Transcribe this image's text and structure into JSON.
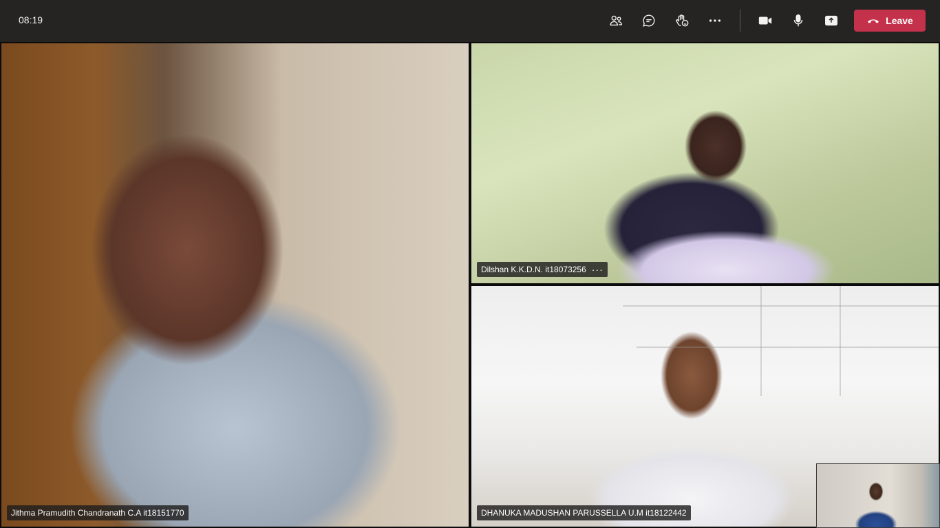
{
  "header": {
    "time": "08:19",
    "toolbar": {
      "participants_icon": "people-icon",
      "chat_icon": "chat-icon",
      "reactions_icon": "raise-hand-icon",
      "more_icon": "more-options-icon",
      "camera_icon": "video-camera-icon",
      "mic_icon": "microphone-icon",
      "share_icon": "share-screen-icon"
    },
    "leave": {
      "label": "Leave",
      "color": "#c4314b"
    }
  },
  "participants": [
    {
      "name": "Jithma Pramudith Chandranath C.A it18151770"
    },
    {
      "name": "Dilshan K.K.D.N. it18073256",
      "more": "···"
    },
    {
      "name": "DHANUKA MADUSHAN PARUSSELLA U.M it18122442"
    }
  ],
  "self_view": {
    "label": "self-preview"
  }
}
